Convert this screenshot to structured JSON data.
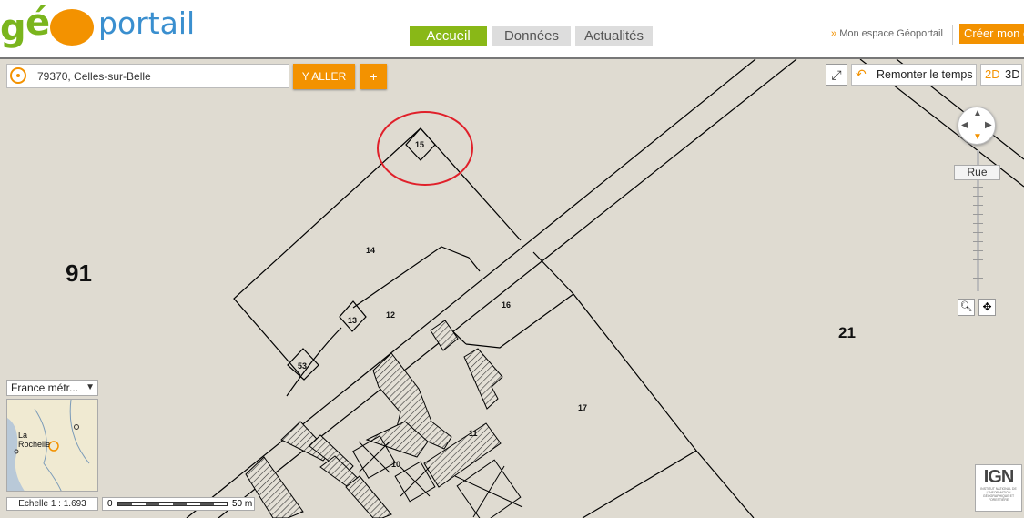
{
  "header": {
    "logo": {
      "part1": "g",
      "part2": "é",
      "part3": "portail"
    },
    "tabs": [
      {
        "label": "Accueil",
        "active": true
      },
      {
        "label": "Données",
        "active": false
      },
      {
        "label": "Actualités",
        "active": false
      }
    ],
    "mon_espace_prefix": "»",
    "mon_espace": "Mon espace Géoportail",
    "creer_button": "Créer mon c"
  },
  "search": {
    "value": "79370, Celles-sur-Belle",
    "go_button": "Y ALLER",
    "plus_button": "+"
  },
  "map_controls": {
    "remonter_le_temps": "Remonter le temps",
    "mode_2d": "2D",
    "mode_3d": "3D",
    "zoom_level_label": "Rue",
    "region_select": "France métr...",
    "minimap_place": {
      "line1": "La",
      "line2": "Rochelle"
    },
    "scale_text": "Echelle 1 :  1.693",
    "scale_bar_start": "0",
    "scale_bar_end": "50 m"
  },
  "cadastre": {
    "sections": [
      "91",
      "21"
    ],
    "parcels": [
      "15",
      "14",
      "12",
      "13",
      "53",
      "16",
      "17",
      "11",
      "10"
    ],
    "highlighted_parcel": "15",
    "highlight_color": "#e0202a"
  },
  "ign_logo": {
    "title": "IGN",
    "subtitle": "INSTITUT NATIONAL DE L'INFORMATION GÉOGRAPHIQUE ET FORESTIÈRE"
  },
  "colors": {
    "accent_orange": "#f39200",
    "accent_green": "#89b817",
    "map_background": "#dfdbd1"
  }
}
